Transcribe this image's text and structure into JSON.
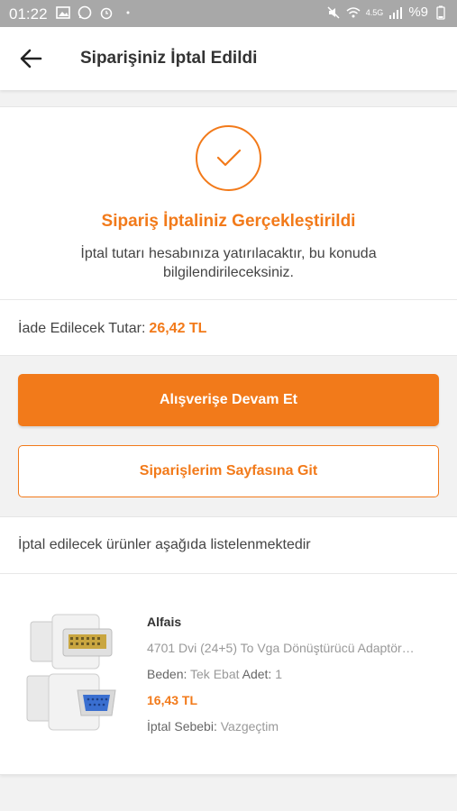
{
  "status_bar": {
    "time": "01:22",
    "network": "4.5G",
    "battery": "%9"
  },
  "header": {
    "title": "Siparişiniz İptal Edildi"
  },
  "confirmation": {
    "title": "Sipariş İptaliniz Gerçekleştirildi",
    "description": "İptal tutarı hesabınıza yatırılacaktır, bu konuda bilgilendirileceksiniz.",
    "refund_label": "İade Edilecek Tutar:",
    "refund_amount": "26,42 TL"
  },
  "buttons": {
    "continue_shopping": "Alışverişe Devam Et",
    "go_orders": "Siparişlerim Sayfasına Git"
  },
  "cancelled_items": {
    "header": "İptal edilecek ürünler aşağıda listelenmektedir",
    "items": [
      {
        "brand": "Alfais",
        "name": "4701 Dvi (24+5) To Vga Dönüştürücü Adaptör…",
        "size_label": "Beden:",
        "size_value": "Tek Ebat",
        "qty_label": "Adet:",
        "qty_value": "1",
        "price": "16,43 TL",
        "reason_label": "İptal Sebebi:",
        "reason_value": "Vazgeçtim"
      }
    ]
  },
  "colors": {
    "accent": "#f27a1a",
    "status_bar": "#a8a8a8",
    "background": "#f2f2f2"
  }
}
